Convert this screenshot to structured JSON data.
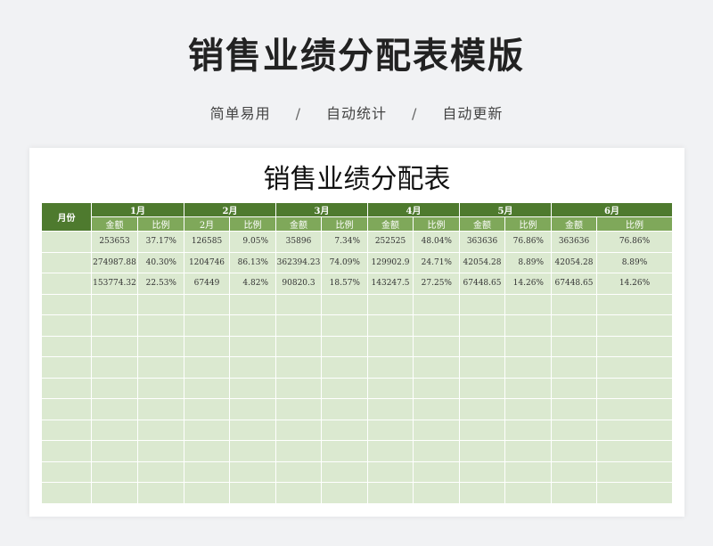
{
  "header": {
    "title": "销售业绩分配表模版",
    "features": [
      "简单易用",
      "自动统计",
      "自动更新"
    ],
    "separator": "/"
  },
  "sheet": {
    "title": "销售业绩分配表",
    "month_col_label": "月份",
    "months": [
      {
        "label": "1月",
        "sub": [
          "金额",
          "比例"
        ]
      },
      {
        "label": "2月",
        "sub": [
          "2月",
          "比例"
        ]
      },
      {
        "label": "3月",
        "sub": [
          "金额",
          "比例"
        ]
      },
      {
        "label": "4月",
        "sub": [
          "金额",
          "比例"
        ]
      },
      {
        "label": "5月",
        "sub": [
          "金额",
          "比例"
        ]
      },
      {
        "label": "6月",
        "sub": [
          "金额",
          "比例"
        ]
      }
    ],
    "rows": [
      [
        "",
        "253653",
        "37.17%",
        "126585",
        "9.05%",
        "35896",
        "7.34%",
        "252525",
        "48.04%",
        "363636",
        "76.86%",
        "363636",
        "76.86%"
      ],
      [
        "",
        "274987.88",
        "40.30%",
        "1204746",
        "86.13%",
        "362394.23",
        "74.09%",
        "129902.9",
        "24.71%",
        "42054.28",
        "8.89%",
        "42054.28",
        "8.89%"
      ],
      [
        "",
        "153774.32",
        "22.53%",
        "67449",
        "4.82%",
        "90820.3",
        "18.57%",
        "143247.5",
        "27.25%",
        "67448.65",
        "14.26%",
        "67448.65",
        "14.26%"
      ]
    ],
    "empty_rows": 10
  },
  "colors": {
    "header_dark_green": "#4e7a2e",
    "header_light_green": "#7fa85a",
    "cell_green": "#dbe9d0"
  }
}
